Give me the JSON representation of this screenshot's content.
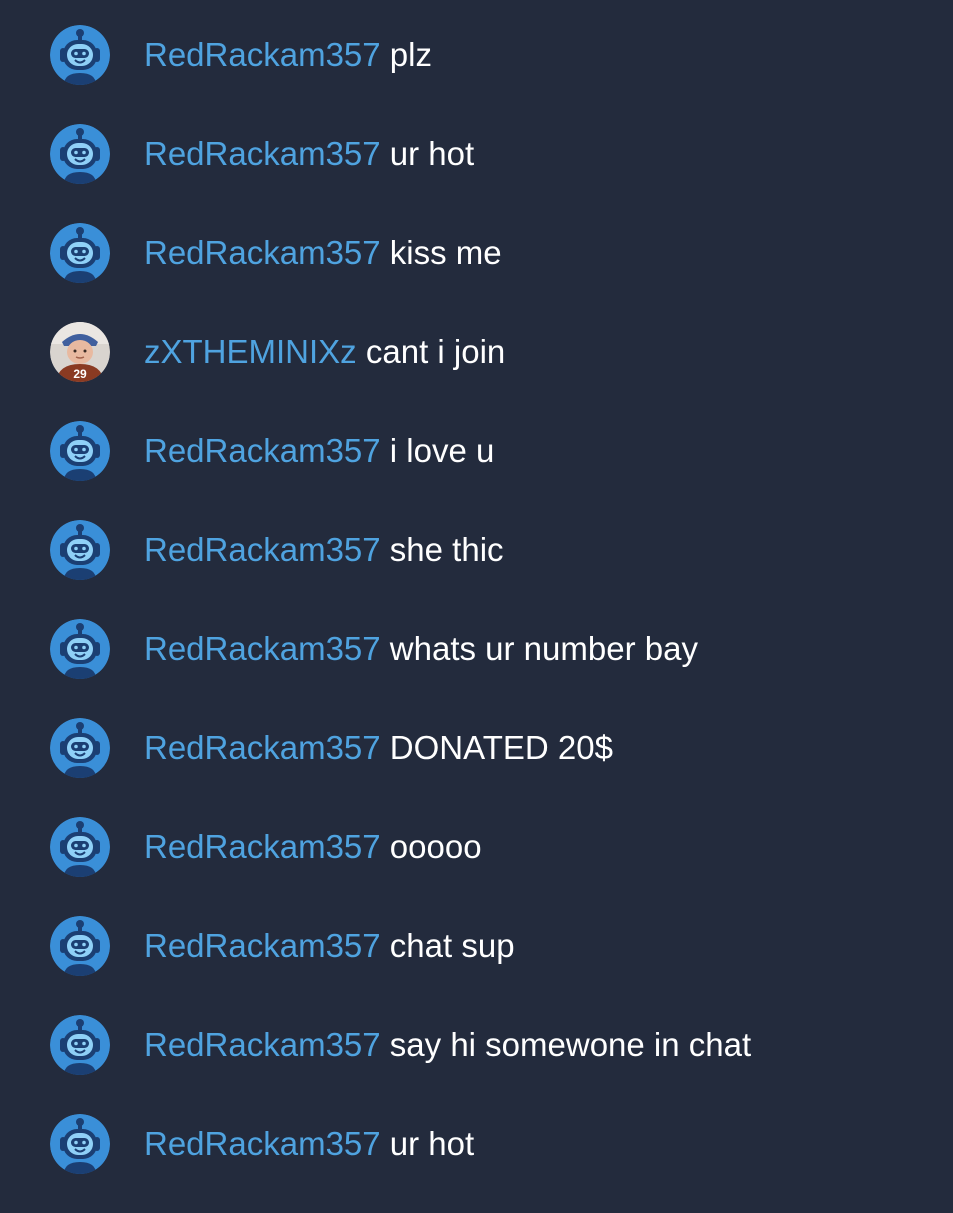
{
  "chat": {
    "messages": [
      {
        "username": "RedRackam357",
        "text": "plz",
        "avatar": "robot-icon"
      },
      {
        "username": "RedRackam357",
        "text": "ur hot",
        "avatar": "robot-icon"
      },
      {
        "username": "RedRackam357",
        "text": "kiss me",
        "avatar": "robot-icon"
      },
      {
        "username": "zXTHEMINIXz",
        "text": "cant i join",
        "avatar": "user-photo"
      },
      {
        "username": "RedRackam357",
        "text": "i love u",
        "avatar": "robot-icon"
      },
      {
        "username": "RedRackam357",
        "text": "she thic",
        "avatar": "robot-icon"
      },
      {
        "username": "RedRackam357",
        "text": "whats ur number bay",
        "avatar": "robot-icon"
      },
      {
        "username": "RedRackam357",
        "text": "DONATED 20$",
        "avatar": "robot-icon"
      },
      {
        "username": "RedRackam357",
        "text": "ooooo",
        "avatar": "robot-icon"
      },
      {
        "username": "RedRackam357",
        "text": "chat sup",
        "avatar": "robot-icon"
      },
      {
        "username": "RedRackam357",
        "text": "say hi somewone in chat",
        "avatar": "robot-icon"
      },
      {
        "username": "RedRackam357",
        "text": "ur hot",
        "avatar": "robot-icon"
      }
    ]
  },
  "colors": {
    "background": "#232b3d",
    "username": "#4fa3e0",
    "message_text": "#ffffff",
    "robot_avatar_bg": "#3a8fd8"
  }
}
